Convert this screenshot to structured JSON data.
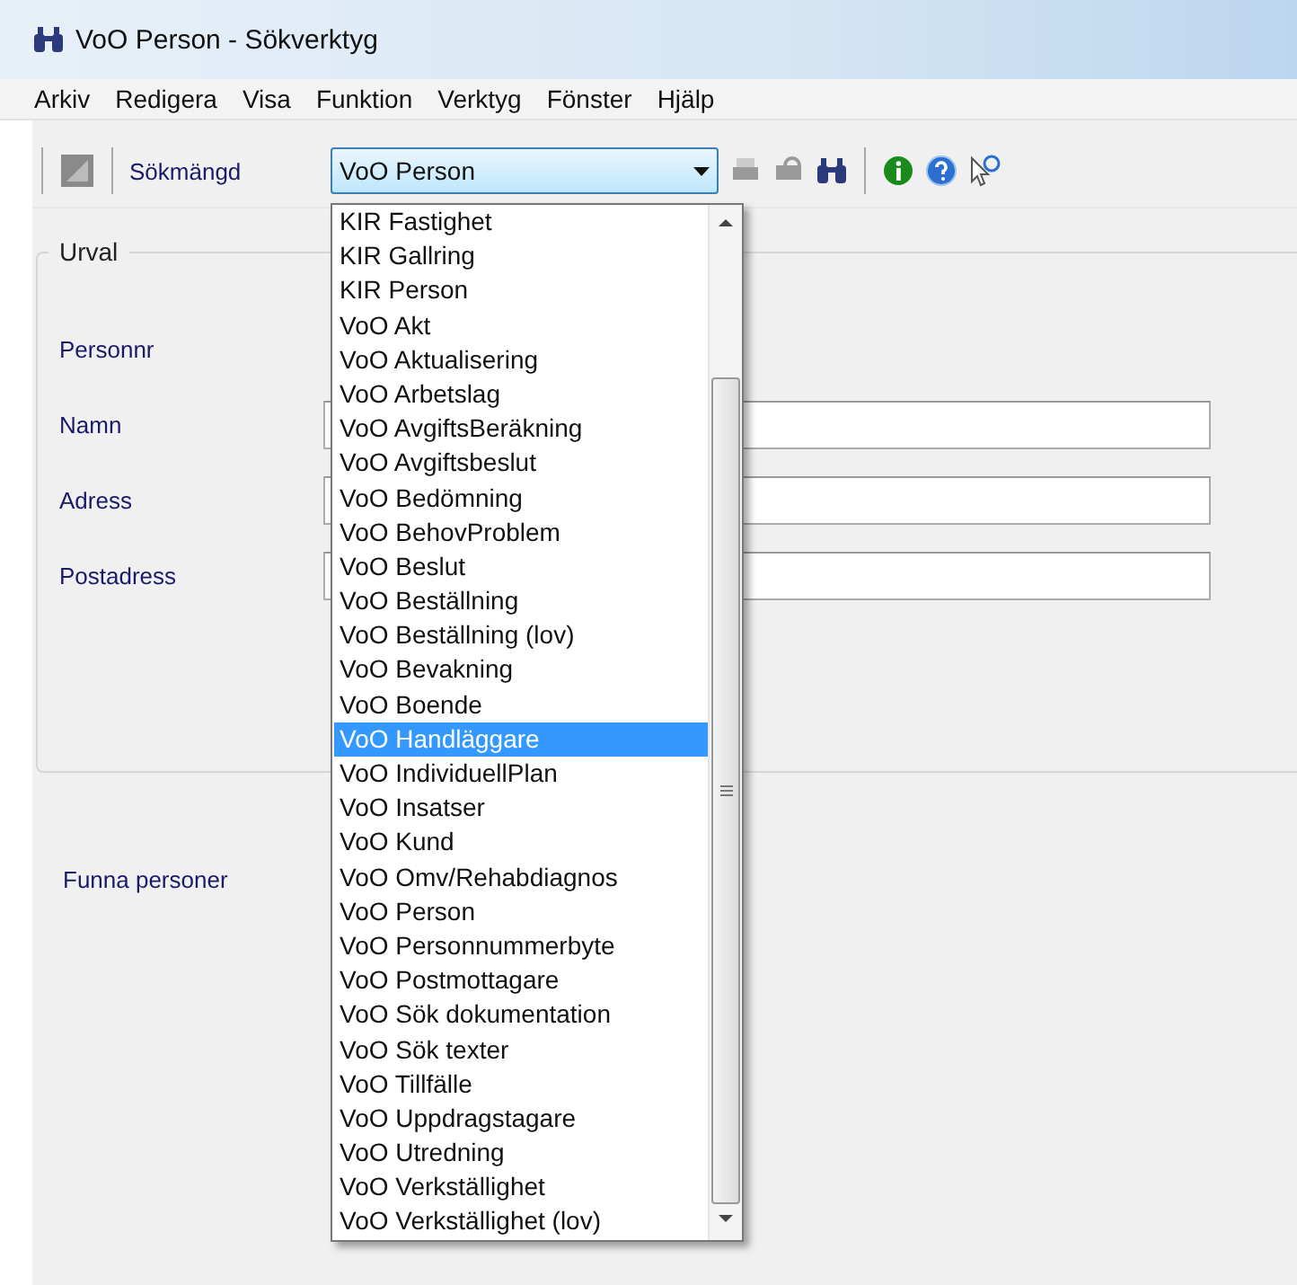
{
  "window": {
    "title": "VoO Person - Sökverktyg"
  },
  "menu": [
    "Arkiv",
    "Redigera",
    "Visa",
    "Funktion",
    "Verktyg",
    "Fönster",
    "Hjälp"
  ],
  "toolbar": {
    "label": "Sökmängd",
    "combo_value": "VoO Person",
    "buttons": [
      {
        "kind": "print",
        "disabled": true
      },
      {
        "kind": "preview",
        "disabled": true
      },
      {
        "kind": "find",
        "disabled": false
      },
      {
        "kind": "separator"
      },
      {
        "kind": "info",
        "disabled": false
      },
      {
        "kind": "help",
        "disabled": false
      },
      {
        "kind": "whatsthis",
        "disabled": false
      }
    ]
  },
  "dropdown": {
    "expanded": true,
    "items": [
      {
        "label": "KIR Fastighet",
        "selected": false
      },
      {
        "label": "KIR Gallring",
        "selected": false
      },
      {
        "label": "KIR Person",
        "selected": false
      },
      {
        "label": "VoO Akt",
        "selected": false
      },
      {
        "label": "VoO Aktualisering",
        "selected": false
      },
      {
        "label": "VoO Arbetslag",
        "selected": false
      },
      {
        "label": "VoO AvgiftsBeräkning",
        "selected": false
      },
      {
        "label": "VoO Avgiftsbeslut",
        "selected": false
      },
      {
        "label": "VoO Bedömning",
        "selected": false
      },
      {
        "label": "VoO BehovProblem",
        "selected": false
      },
      {
        "label": "VoO Beslut",
        "selected": false
      },
      {
        "label": "VoO Beställning",
        "selected": false
      },
      {
        "label": "VoO Beställning (lov)",
        "selected": false
      },
      {
        "label": "VoO Bevakning",
        "selected": false
      },
      {
        "label": "VoO Boende",
        "selected": false
      },
      {
        "label": "VoO Handläggare",
        "selected": true
      },
      {
        "label": "VoO IndividuellPlan",
        "selected": false
      },
      {
        "label": "VoO Insatser",
        "selected": false
      },
      {
        "label": "VoO Kund",
        "selected": false
      },
      {
        "label": "VoO Omv/Rehabdiagnos",
        "selected": false
      },
      {
        "label": "VoO Person",
        "selected": false
      },
      {
        "label": "VoO Personnummerbyte",
        "selected": false
      },
      {
        "label": "VoO Postmottagare",
        "selected": false
      },
      {
        "label": "VoO Sök dokumentation",
        "selected": false
      },
      {
        "label": "VoO Sök texter",
        "selected": false
      },
      {
        "label": "VoO Tillfälle",
        "selected": false
      },
      {
        "label": "VoO Uppdragstagare",
        "selected": false
      },
      {
        "label": "VoO Utredning",
        "selected": false
      },
      {
        "label": "VoO Verkställighet",
        "selected": false
      },
      {
        "label": "VoO Verkställighet (lov)",
        "selected": false
      }
    ]
  },
  "form": {
    "group_title": "Urval",
    "fields": [
      {
        "label": "Personnr",
        "kind": "label"
      },
      {
        "label": "Namn",
        "kind": "field"
      },
      {
        "label": "Adress",
        "kind": "field"
      },
      {
        "label": "Postadress",
        "kind": "field"
      }
    ]
  },
  "results": {
    "label": "Funna personer"
  }
}
